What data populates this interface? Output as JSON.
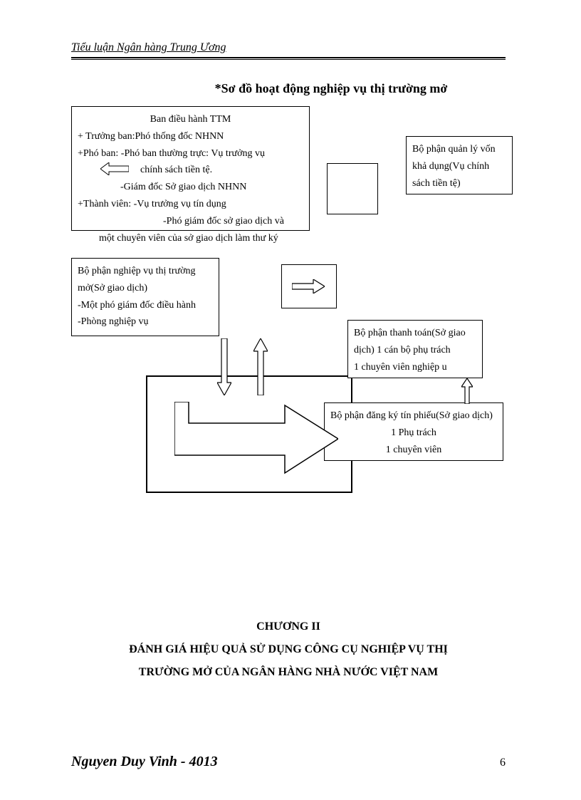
{
  "header": "Tiểu luận Ngân hàng Trung Ương",
  "title": "*Sơ đồ hoạt động nghiệp vụ thị trường mở",
  "diagram": {
    "main_box": {
      "l1": "Ban điều hành TTM",
      "l2": "+ Trưởng ban:Phó thống đốc NHNN",
      "l3": " +Phó ban: -Phó ban thường trực: Vụ trưởng vụ",
      "l4": "chính sách tiền tệ.",
      "l5": "-Giám đốc Sở giao dịch NHNN",
      "l6": "+Thành viên:  -Vụ trưởng vụ tín dụng",
      "l7": "-Phó giám đốc sở giao dịch và",
      "l8": "một chuyên viên của sở giao dịch làm thư ký"
    },
    "capital_box": {
      "l1": "Bộ phận quản lý vốn khả dụng(Vụ chính sách tiền tệ)"
    },
    "ops_box": {
      "l1": "Bộ phận nghiệp vụ thị trường mở(Sở giao dịch)",
      "l2": "-Một phó giám đốc điều hành",
      "l3": "-Phòng nghiệp vụ"
    },
    "pay_box": {
      "l1": "Bộ phận thanh toán(Sở giao dịch)  1 cán bộ phụ trách",
      "l2": "1 chuyên viên nghiệp     u"
    },
    "reg_box": {
      "l1": "Bộ phận đăng ký tín phiếu(Sở giao dịch)",
      "l2": "1 Phụ trách",
      "l3": "1 chuyên viên"
    }
  },
  "chapter": {
    "l1": "CHƯƠNG II",
    "l2": "ĐÁNH GIÁ HIỆU QUẢ SỬ DỤNG CÔNG CỤ NGHIỆP VỤ THỊ",
    "l3": "TRƯỜNG MỞ CỦA NGÂN HÀNG NHÀ NƯỚC VIỆT NAM"
  },
  "footer": {
    "author": "Nguyen Duy Vinh - 4013",
    "page": "6"
  }
}
